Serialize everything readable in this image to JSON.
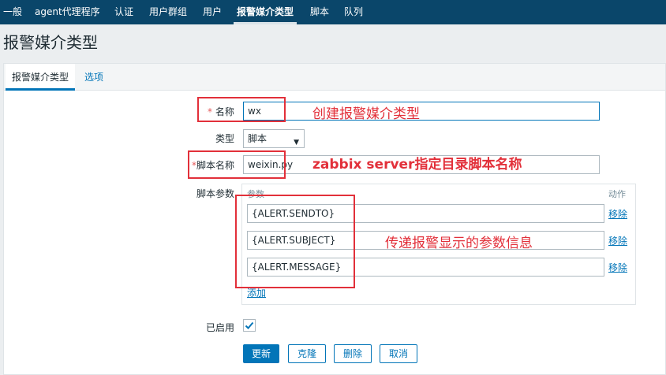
{
  "topnav": {
    "items": [
      {
        "label": "一般"
      },
      {
        "label": "agent代理程序"
      },
      {
        "label": "认证"
      },
      {
        "label": "用户群组"
      },
      {
        "label": "用户"
      },
      {
        "label": "报警媒介类型",
        "active": true
      },
      {
        "label": "脚本"
      },
      {
        "label": "队列"
      }
    ]
  },
  "page": {
    "title": "报警媒介类型"
  },
  "tabs": [
    {
      "label": "报警媒介类型",
      "active": true
    },
    {
      "label": "选项"
    }
  ],
  "form": {
    "name": {
      "required": "*",
      "label": "名称",
      "value": "wx"
    },
    "type": {
      "label": "类型",
      "value": "脚本"
    },
    "script_name": {
      "required": "*",
      "label": "脚本名称",
      "value": "weixin.py"
    },
    "script_params": {
      "label": "脚本参数",
      "col_param": "参数",
      "col_action": "动作",
      "rows": [
        {
          "value": "{ALERT.SENDTO}",
          "remove": "移除"
        },
        {
          "value": "{ALERT.SUBJECT}",
          "remove": "移除"
        },
        {
          "value": "{ALERT.MESSAGE}",
          "remove": "移除"
        }
      ],
      "add": "添加"
    },
    "enabled": {
      "label": "已启用",
      "checked": true
    }
  },
  "buttons": {
    "update": "更新",
    "clone": "克隆",
    "delete": "删除",
    "cancel": "取消"
  },
  "annotations": {
    "create": "创建报警媒介类型",
    "script_dir": "zabbix server指定目录脚本名称",
    "params_info": "传递报警显示的参数信息"
  },
  "colors": {
    "nav": "#0a466a",
    "accent": "#0275b8",
    "annotation": "#e2303a",
    "required": "#e45959"
  }
}
